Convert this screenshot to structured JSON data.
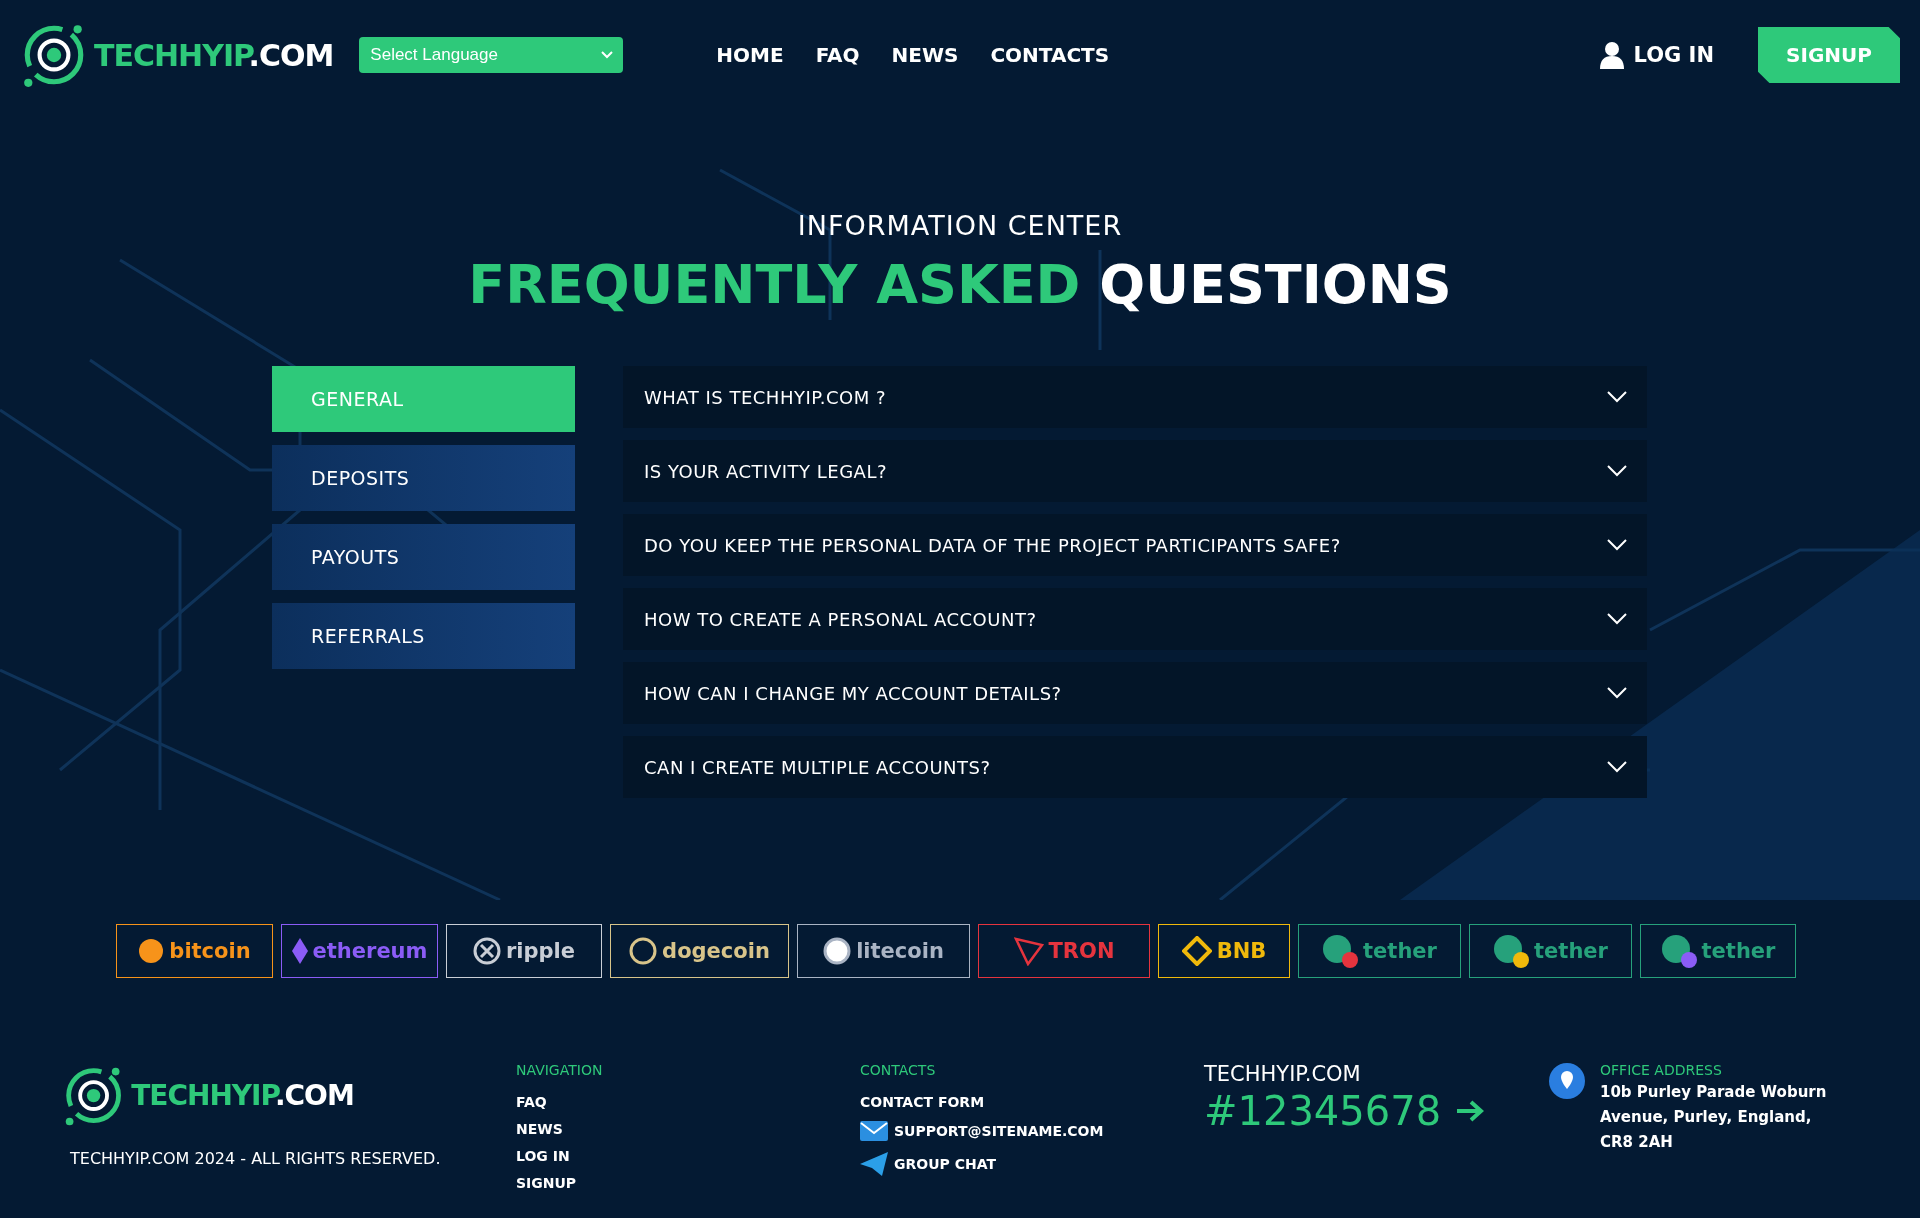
{
  "header": {
    "logo": {
      "text": "TECHHYIP",
      "suffix": ".COM"
    },
    "language_select": {
      "value": "Select Language"
    },
    "nav": [
      {
        "label": "HOME"
      },
      {
        "label": "FAQ"
      },
      {
        "label": "NEWS"
      },
      {
        "label": "CONTACTS"
      }
    ],
    "login": "LOG IN",
    "signup": "SIGNUP"
  },
  "hero": {
    "eyebrow": "INFORMATION CENTER",
    "title_accent": "FREQUENTLY ASKED",
    "title_rest": "QUESTIONS"
  },
  "categories": [
    {
      "label": "GENERAL",
      "selected": true
    },
    {
      "label": "DEPOSITS",
      "selected": false
    },
    {
      "label": "PAYOUTS",
      "selected": false
    },
    {
      "label": "REFERRALS",
      "selected": false
    }
  ],
  "questions": [
    {
      "text": "WHAT IS TECHHYIP.COM ?",
      "expanded": false
    },
    {
      "text": "IS YOUR ACTIVITY LEGAL?",
      "expanded": false
    },
    {
      "text": "DO YOU KEEP THE PERSONAL DATA OF THE PROJECT PARTICIPANTS SAFE?",
      "expanded": false
    },
    {
      "text": "HOW TO CREATE A PERSONAL ACCOUNT?",
      "expanded": false
    },
    {
      "text": "HOW CAN I CHANGE MY ACCOUNT DETAILS?",
      "expanded": false
    },
    {
      "text": "CAN I CREATE MULTIPLE ACCOUNTS?",
      "expanded": false
    }
  ],
  "payment_methods": [
    {
      "label": "bitcoin",
      "color": "#f7931a",
      "kind": "bitcoin"
    },
    {
      "label": "ethereum",
      "color": "#8b5cf6",
      "kind": "ethereum"
    },
    {
      "label": "ripple",
      "color": "#c9ced6",
      "kind": "ripple"
    },
    {
      "label": "dogecoin",
      "color": "#d8c48a",
      "kind": "dogecoin"
    },
    {
      "label": "litecoin",
      "color": "#aab4c4",
      "kind": "litecoin"
    },
    {
      "label": "TRON",
      "color": "#e5343e",
      "kind": "tron"
    },
    {
      "label": "BNB",
      "color": "#f0b90b",
      "kind": "bnb"
    },
    {
      "label": "tether",
      "color": "#26a17b",
      "kind": "tether-tron"
    },
    {
      "label": "tether",
      "color": "#26a17b",
      "kind": "tether-bnb"
    },
    {
      "label": "tether",
      "color": "#26a17b",
      "kind": "tether-eth"
    }
  ],
  "footer": {
    "logo": {
      "text": "TECHHYIP",
      "suffix": ".COM"
    },
    "copyright": "TECHHYIP.COM 2024 - ALL RIGHTS RESERVED.",
    "navigation": {
      "title": "NAVIGATION",
      "links": [
        "FAQ",
        "NEWS",
        "LOG IN",
        "SIGNUP"
      ]
    },
    "contacts": {
      "title": "CONTACTS",
      "form": "CONTACT FORM",
      "email": "SUPPORT@SITENAME.COM",
      "chat": "GROUP CHAT"
    },
    "company": {
      "name": "TECHHYIP.COM",
      "number": "#12345678"
    },
    "office": {
      "title": "OFFICE ADDRESS",
      "address": "10b Purley Parade Woburn Avenue, Purley, England, CR8 2AH"
    }
  }
}
